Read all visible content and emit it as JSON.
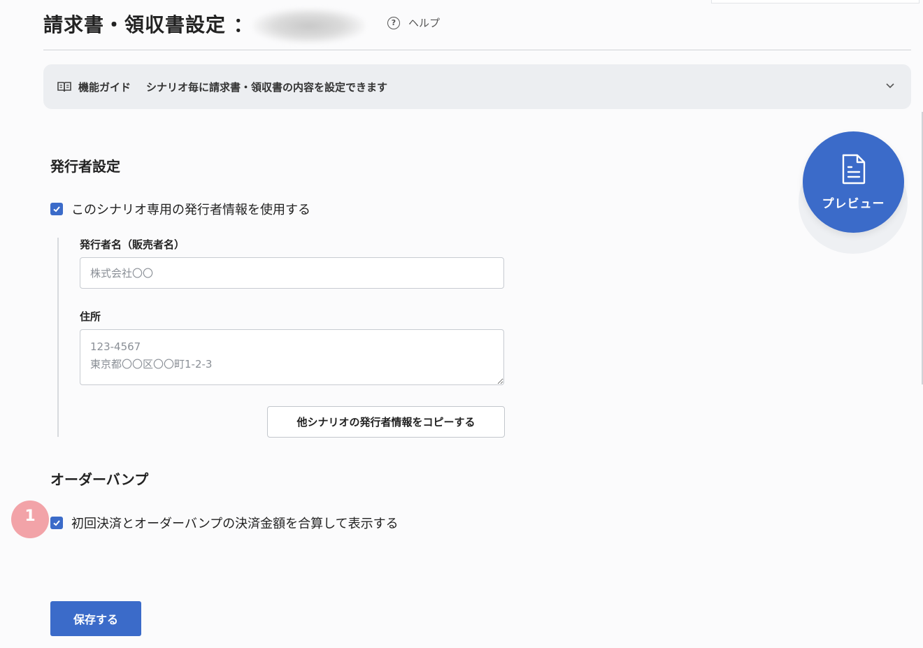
{
  "header": {
    "title": "請求書・領収書設定 ：",
    "help_label": "ヘルプ",
    "help_icon": "question-circle-icon"
  },
  "guide": {
    "icon": "book-open-icon",
    "label": "機能ガイド",
    "text": "シナリオ毎に請求書・領収書の内容を設定できます",
    "chevron_icon": "chevron-down-icon"
  },
  "issuer_section": {
    "title": "発行者設定",
    "use_own_issuer": {
      "label": "このシナリオ専用の発行者情報を使用する",
      "checked": true
    },
    "issuer_name": {
      "label": "発行者名（販売者名）",
      "placeholder": "株式会社〇〇",
      "value": ""
    },
    "address": {
      "label": "住所",
      "placeholder": "123-4567\n東京都〇〇区〇〇町1-2-3",
      "value": ""
    },
    "copy_button": "他シナリオの発行者情報をコピーする"
  },
  "order_bump_section": {
    "title": "オーダーバンプ",
    "combine_amount": {
      "label": "初回決済とオーダーバンプの決済金額を合算して表示する",
      "checked": true
    },
    "badge_number": "1"
  },
  "preview_button": {
    "label": "プレビュー",
    "icon": "document-icon"
  },
  "save_button": "保存する",
  "colors": {
    "primary": "#3b6bc9",
    "badge": "#f2a3a8",
    "guide_bg": "#eceef1"
  }
}
